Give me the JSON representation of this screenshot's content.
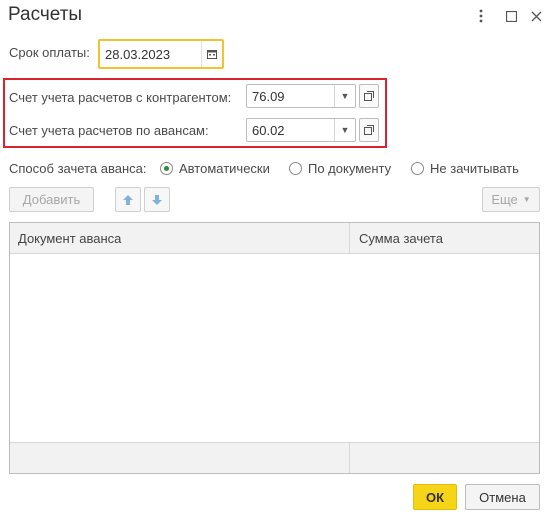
{
  "window": {
    "title": "Расчеты",
    "icons": [
      "more-vertical-icon",
      "maximize-icon",
      "close-icon"
    ]
  },
  "payment_due": {
    "label": "Срок оплаты:",
    "value": "28.03.2023",
    "icon": "calendar-icon"
  },
  "accounts": {
    "counterparty_label": "Счет учета расчетов с контрагентом:",
    "counterparty_value": "76.09",
    "advances_label": "Счет учета расчетов по авансам:",
    "advances_value": "60.02",
    "highlight_color": "#d9232e"
  },
  "offset_method": {
    "label": "Способ зачета аванса:",
    "options": [
      "Автоматически",
      "По документу",
      "Не зачитывать"
    ],
    "selected": "Автоматически"
  },
  "toolbar": {
    "add_label": "Добавить",
    "more_label": "Еще"
  },
  "table": {
    "columns": [
      "Документ аванса",
      "Сумма зачета"
    ],
    "rows": []
  },
  "footer": {
    "ok_label": "ОК",
    "cancel_label": "Отмена"
  },
  "colors": {
    "date_focus_border": "#f2c230",
    "ok_button": "#f6d417",
    "arrow_buttons": "#7fb3de"
  }
}
